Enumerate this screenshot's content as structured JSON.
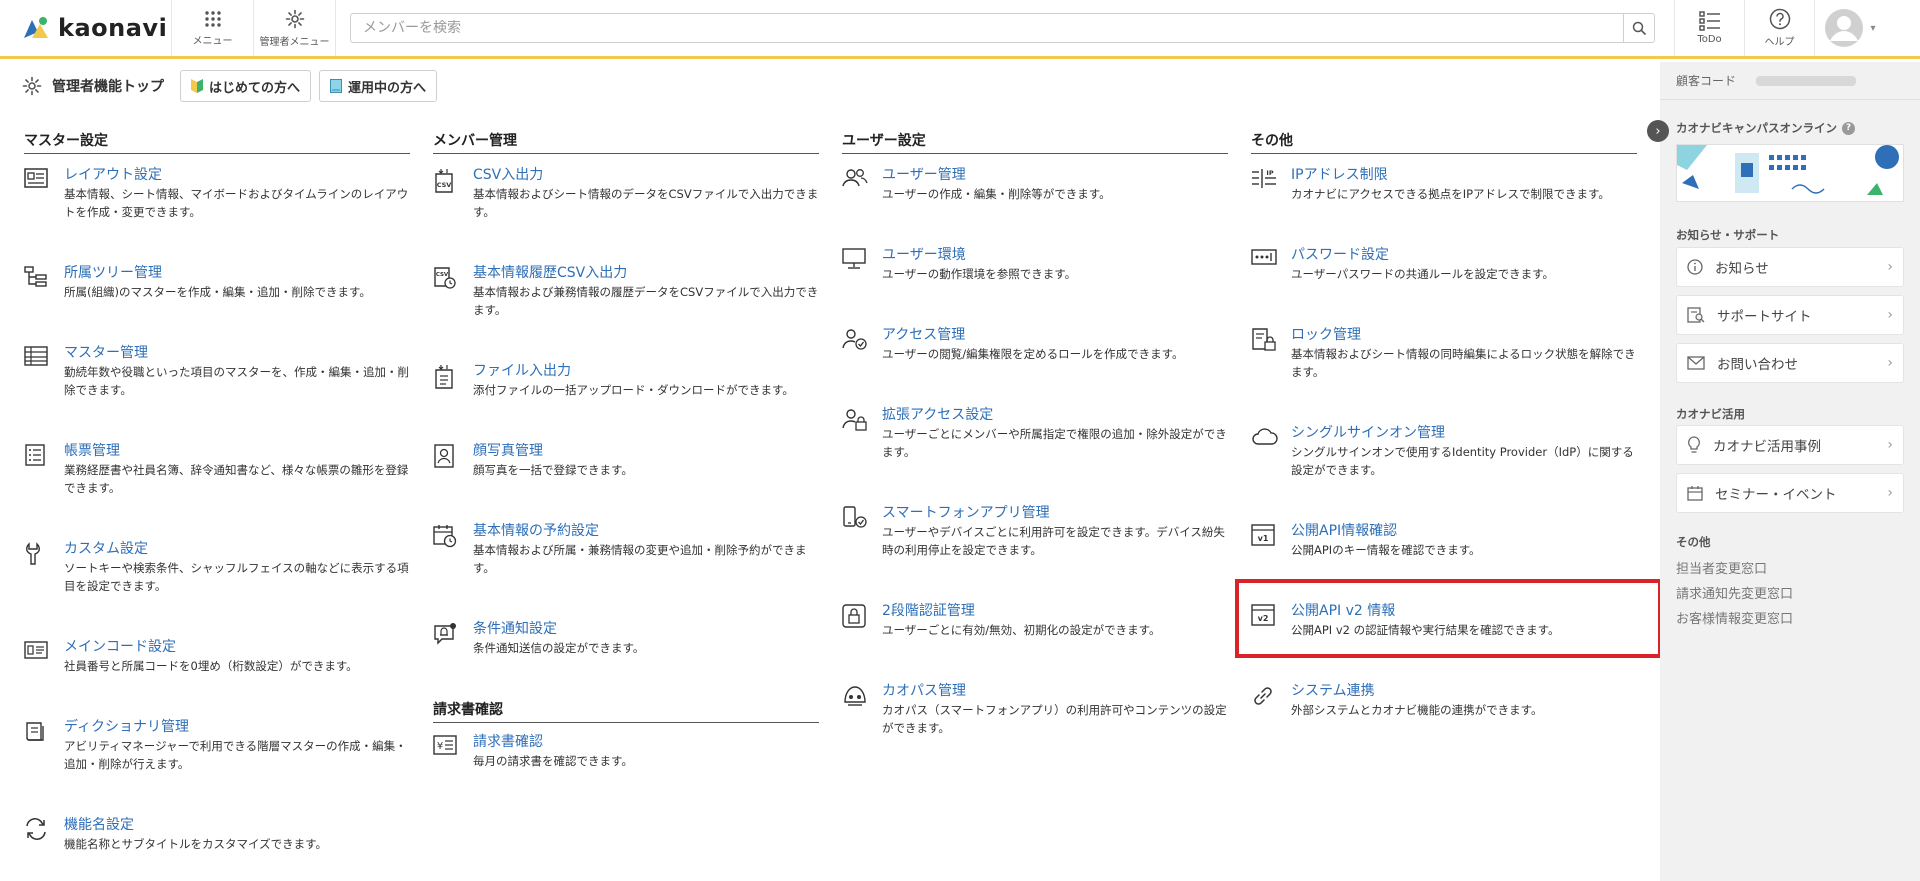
{
  "header": {
    "logo": "kaonavi",
    "menu_label": "メニュー",
    "admin_menu_label": "管理者メニュー",
    "search_placeholder": "メンバーを検索",
    "todo_label": "ToDo",
    "help_label": "ヘルプ"
  },
  "subbar": {
    "title": "管理者機能トップ",
    "beginner_button": "はじめての方へ",
    "operating_button": "運用中の方へ"
  },
  "columns": [
    {
      "heading": "マスター設定",
      "items": [
        {
          "title": "レイアウト設定",
          "desc": "基本情報、シート情報、マイボードおよびタイムラインのレイアウトを作成・変更できます。",
          "icon": "layout-icon"
        },
        {
          "title": "所属ツリー管理",
          "desc": "所属(組織)のマスターを作成・編集・追加・削除できます。",
          "icon": "tree-icon"
        },
        {
          "title": "マスター管理",
          "desc": "勤続年数や役職といった項目のマスターを、作成・編集・追加・削除できます。",
          "icon": "table-icon"
        },
        {
          "title": "帳票管理",
          "desc": "業務経歴書や社員名簿、辞令通知書など、様々な帳票の雛形を登録できます。",
          "icon": "list-doc-icon"
        },
        {
          "title": "カスタム設定",
          "desc": "ソートキーや検索条件、シャッフルフェイスの軸などに表示する項目を設定できます。",
          "icon": "wrench-icon"
        },
        {
          "title": "メインコード設定",
          "desc": "社員番号と所属コードを0埋め（桁数設定）ができます。",
          "icon": "id-card-icon"
        },
        {
          "title": "ディクショナリ管理",
          "desc": "アビリティマネージャーで利用できる階層マスターの作成・編集・追加・削除が行えます。",
          "icon": "dictionary-icon"
        },
        {
          "title": "機能名設定",
          "desc": "機能名称とサブタイトルをカスタマイズできます。",
          "icon": "swap-icon"
        }
      ]
    },
    {
      "heading": "メンバー管理",
      "items": [
        {
          "title": "CSV入出力",
          "desc": "基本情報およびシート情報のデータをCSVファイルで入出力できます。",
          "icon": "csv-icon"
        },
        {
          "title": "基本情報履歴CSV入出力",
          "desc": "基本情報および兼務情報の履歴データをCSVファイルで入出力できます。",
          "icon": "csv-history-icon"
        },
        {
          "title": "ファイル入出力",
          "desc": "添付ファイルの一括アップロード・ダウンロードができます。",
          "icon": "file-io-icon"
        },
        {
          "title": "顔写真管理",
          "desc": "顔写真を一括で登録できます。",
          "icon": "portrait-icon"
        },
        {
          "title": "基本情報の予約設定",
          "desc": "基本情報および所属・兼務情報の変更や追加・削除予約ができます。",
          "icon": "calendar-clock-icon"
        },
        {
          "title": "条件通知設定",
          "desc": "条件通知送信の設定ができます。",
          "icon": "bell-chat-icon"
        }
      ],
      "section2_heading": "請求書確認",
      "section2_items": [
        {
          "title": "請求書確認",
          "desc": "毎月の請求書を確認できます。",
          "icon": "invoice-icon"
        }
      ]
    },
    {
      "heading": "ユーザー設定",
      "items": [
        {
          "title": "ユーザー管理",
          "desc": "ユーザーの作成・編集・削除等ができます。",
          "icon": "users-icon"
        },
        {
          "title": "ユーザー環境",
          "desc": "ユーザーの動作環境を参照できます。",
          "icon": "monitor-icon"
        },
        {
          "title": "アクセス管理",
          "desc": "ユーザーの閲覧/編集権限を定めるロールを作成できます。",
          "icon": "user-check-icon"
        },
        {
          "title": "拡張アクセス設定",
          "desc": "ユーザーごとにメンバーや所属指定で権限の追加・除外設定ができます。",
          "icon": "user-lock-icon"
        },
        {
          "title": "スマートフォンアプリ管理",
          "desc": "ユーザーやデバイスごとに利用許可を設定できます。デバイス紛失時の利用停止を設定できます。",
          "icon": "smartphone-icon"
        },
        {
          "title": "2段階認証管理",
          "desc": "ユーザーごとに有効/無効、初期化の設定ができます。",
          "icon": "two-factor-icon"
        },
        {
          "title": "カオパス管理",
          "desc": "カオパス（スマートフォンアプリ）の利用許可やコンテンツの設定ができます。",
          "icon": "kaopass-icon"
        }
      ]
    },
    {
      "heading": "その他",
      "items": [
        {
          "title": "IPアドレス制限",
          "desc": "カオナビにアクセスできる拠点をIPアドレスで制限できます。",
          "icon": "ip-icon"
        },
        {
          "title": "パスワード設定",
          "desc": "ユーザーパスワードの共通ルールを設定できます。",
          "icon": "password-icon"
        },
        {
          "title": "ロック管理",
          "desc": "基本情報およびシート情報の同時編集によるロック状態を解除できます。",
          "icon": "lock-doc-icon"
        },
        {
          "title": "シングルサインオン管理",
          "desc": "シングルサインオンで使用するIdentity Provider（IdP）に関する設定ができます。",
          "icon": "cloud-icon"
        },
        {
          "title": "公開API情報確認",
          "desc": "公開APIのキー情報を確認できます。",
          "icon": "api-v1-icon"
        },
        {
          "title": "公開API v2 情報",
          "desc": "公開API v2 の認証情報や実行結果を確認できます。",
          "icon": "api-v2-icon"
        },
        {
          "title": "システム連携",
          "desc": "外部システムとカオナビ機能の連携ができます。",
          "icon": "link-icon"
        }
      ]
    }
  ],
  "sidebar": {
    "customer_code_label": "顧客コード",
    "campus_title": "カオナビキャンパスオンライン",
    "support_heading": "お知らせ・サポート",
    "support_items": [
      {
        "label": "お知らせ",
        "icon": "info-icon"
      },
      {
        "label": "サポートサイト",
        "icon": "book-search-icon"
      },
      {
        "label": "お問い合わせ",
        "icon": "mail-icon"
      }
    ],
    "usage_heading": "カオナビ活用",
    "usage_items": [
      {
        "label": "カオナビ活用事例",
        "icon": "lightbulb-icon"
      },
      {
        "label": "セミナー・イベント",
        "icon": "calendar-icon"
      }
    ],
    "other_heading": "その他",
    "other_links": [
      "担当者変更窓口",
      "請求通知先変更窓口",
      "お客様情報変更窓口"
    ]
  },
  "colors": {
    "accent_yellow": "#f2c94c",
    "link_blue": "#2e6fb7",
    "highlight_red": "#d9232a",
    "sidebar_bg": "#f1f1f1"
  }
}
